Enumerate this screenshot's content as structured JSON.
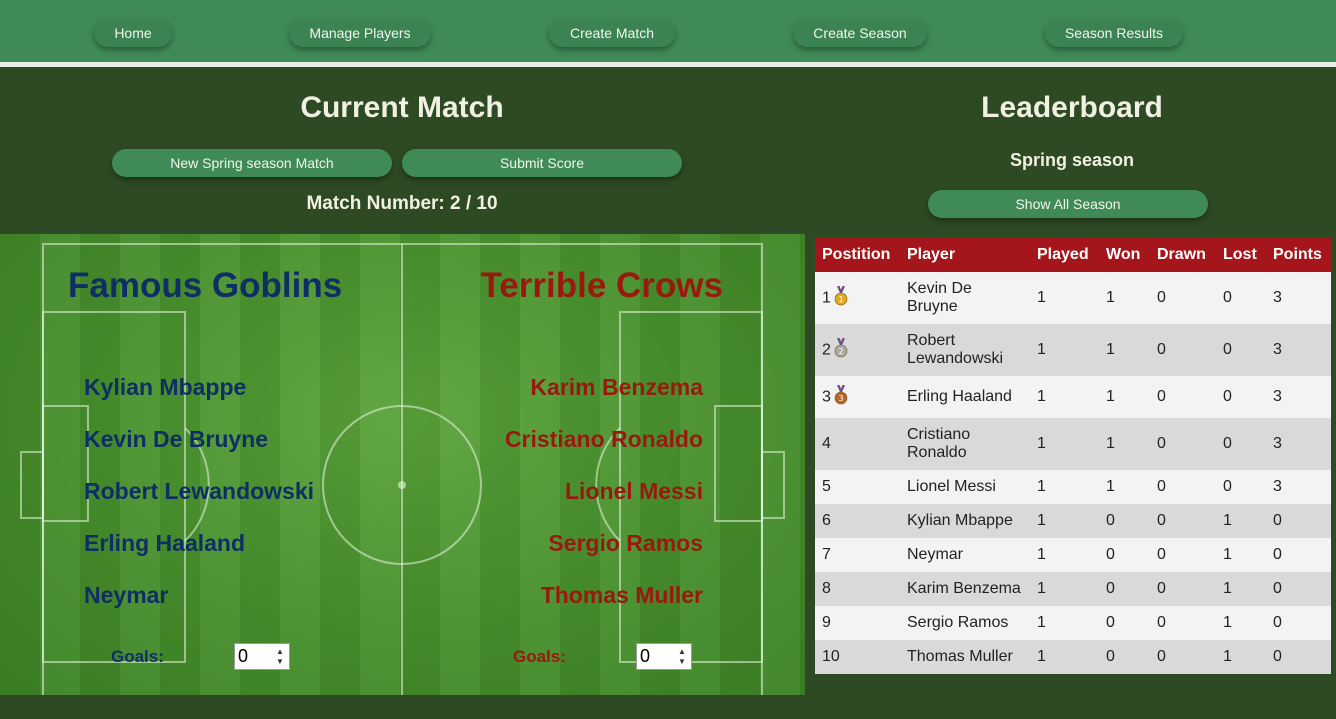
{
  "nav": {
    "items": [
      {
        "label": "Home"
      },
      {
        "label": "Manage Players"
      },
      {
        "label": "Create Match"
      },
      {
        "label": "Create Season"
      },
      {
        "label": "Season Results"
      }
    ]
  },
  "current_match": {
    "title": "Current Match",
    "new_match_label": "New Spring season Match",
    "submit_label": "Submit Score",
    "match_number": "Match Number: 2 / 10"
  },
  "teams": {
    "home": {
      "name": "Famous Goblins",
      "color": "#0e2f64",
      "players": [
        "Kylian Mbappe",
        "Kevin De Bruyne",
        "Robert Lewandowski",
        "Erling Haaland",
        "Neymar"
      ],
      "goals_label": "Goals:",
      "goals_value": "0"
    },
    "away": {
      "name": "Terrible Crows",
      "color": "#981a0f",
      "players": [
        "Karim Benzema",
        "Cristiano Ronaldo",
        "Lionel Messi",
        "Sergio Ramos",
        "Thomas Muller"
      ],
      "goals_label": "Goals:",
      "goals_value": "0"
    }
  },
  "leaderboard": {
    "title": "Leaderboard",
    "season": "Spring season",
    "show_all_label": "Show All Season",
    "header_color": "#a4161b",
    "columns": [
      "Postition",
      "Player",
      "Played",
      "Won",
      "Drawn",
      "Lost",
      "Points"
    ],
    "rows": [
      {
        "pos": "1",
        "medal": "gold-medal-icon",
        "player": "Kevin De Bruyne",
        "played": "1",
        "won": "1",
        "drawn": "0",
        "lost": "0",
        "points": "3"
      },
      {
        "pos": "2",
        "medal": "silver-medal-icon",
        "player": "Robert Lewandowski",
        "played": "1",
        "won": "1",
        "drawn": "0",
        "lost": "0",
        "points": "3"
      },
      {
        "pos": "3",
        "medal": "bronze-medal-icon",
        "player": "Erling Haaland",
        "played": "1",
        "won": "1",
        "drawn": "0",
        "lost": "0",
        "points": "3"
      },
      {
        "pos": "4",
        "medal": "",
        "player": "Cristiano Ronaldo",
        "played": "1",
        "won": "1",
        "drawn": "0",
        "lost": "0",
        "points": "3"
      },
      {
        "pos": "5",
        "medal": "",
        "player": "Lionel Messi",
        "played": "1",
        "won": "1",
        "drawn": "0",
        "lost": "0",
        "points": "3"
      },
      {
        "pos": "6",
        "medal": "",
        "player": "Kylian Mbappe",
        "played": "1",
        "won": "0",
        "drawn": "0",
        "lost": "1",
        "points": "0"
      },
      {
        "pos": "7",
        "medal": "",
        "player": "Neymar",
        "played": "1",
        "won": "0",
        "drawn": "0",
        "lost": "1",
        "points": "0"
      },
      {
        "pos": "8",
        "medal": "",
        "player": "Karim Benzema",
        "played": "1",
        "won": "0",
        "drawn": "0",
        "lost": "1",
        "points": "0"
      },
      {
        "pos": "9",
        "medal": "",
        "player": "Sergio Ramos",
        "played": "1",
        "won": "0",
        "drawn": "0",
        "lost": "1",
        "points": "0"
      },
      {
        "pos": "10",
        "medal": "",
        "player": "Thomas Muller",
        "played": "1",
        "won": "0",
        "drawn": "0",
        "lost": "1",
        "points": "0"
      }
    ]
  }
}
